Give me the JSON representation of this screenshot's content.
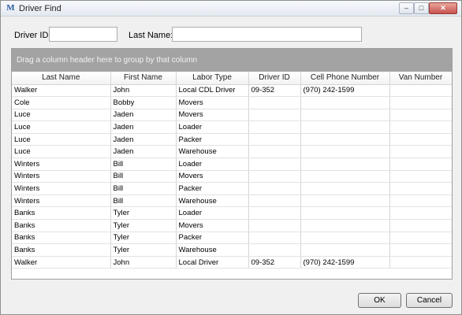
{
  "window": {
    "title": "Driver Find",
    "app_icon_glyph": "M",
    "min_glyph": "–",
    "max_glyph": "□",
    "close_glyph": "✕"
  },
  "filters": {
    "driver_id_label": "Driver ID:",
    "driver_id_value": "",
    "last_name_label": "Last Name:",
    "last_name_value": ""
  },
  "grid": {
    "group_hint": "Drag a column header here to group by that column",
    "columns": [
      "Last Name",
      "First Name",
      "Labor Type",
      "Driver ID",
      "Cell Phone Number",
      "Van Number"
    ],
    "rows": [
      [
        "Walker",
        "John",
        "Local CDL Driver",
        "09-352",
        "(970) 242-1599",
        ""
      ],
      [
        "Cole",
        "Bobby",
        "Movers",
        "",
        "",
        ""
      ],
      [
        "Luce",
        "Jaden",
        "Movers",
        "",
        "",
        ""
      ],
      [
        "Luce",
        "Jaden",
        "Loader",
        "",
        "",
        ""
      ],
      [
        "Luce",
        "Jaden",
        "Packer",
        "",
        "",
        ""
      ],
      [
        "Luce",
        "Jaden",
        "Warehouse",
        "",
        "",
        ""
      ],
      [
        "Winters",
        "Bill",
        "Loader",
        "",
        "",
        ""
      ],
      [
        "Winters",
        "Bill",
        "Movers",
        "",
        "",
        ""
      ],
      [
        "Winters",
        "Bill",
        "Packer",
        "",
        "",
        ""
      ],
      [
        "Winters",
        "Bill",
        "Warehouse",
        "",
        "",
        ""
      ],
      [
        "Banks",
        "Tyler",
        "Loader",
        "",
        "",
        ""
      ],
      [
        "Banks",
        "Tyler",
        "Movers",
        "",
        "",
        ""
      ],
      [
        "Banks",
        "Tyler",
        "Packer",
        "",
        "",
        ""
      ],
      [
        "Banks",
        "Tyler",
        "Warehouse",
        "",
        "",
        ""
      ],
      [
        "Walker",
        "John",
        "Local Driver",
        "09-352",
        "(970) 242-1599",
        ""
      ]
    ]
  },
  "buttons": {
    "ok_label": "OK",
    "cancel_label": "Cancel"
  }
}
